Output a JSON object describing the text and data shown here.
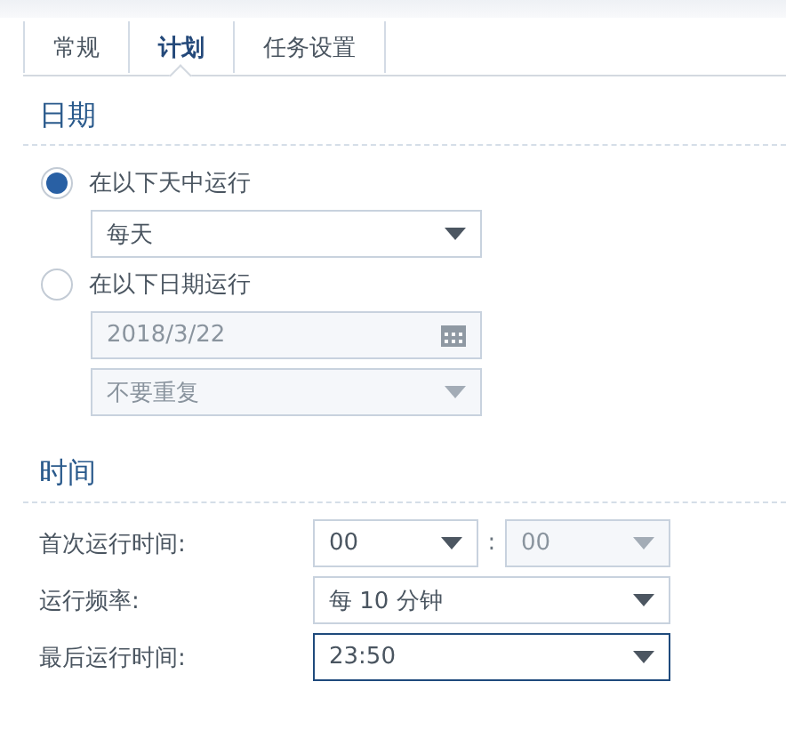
{
  "tabs": [
    {
      "label": "常规",
      "selected": false
    },
    {
      "label": "计划",
      "selected": true
    },
    {
      "label": "任务设置",
      "selected": false
    }
  ],
  "date_section": {
    "title": "日期",
    "options": [
      {
        "label": "在以下天中运行",
        "selected": true,
        "fields": [
          {
            "kind": "select",
            "value": "每天",
            "disabled": false
          }
        ]
      },
      {
        "label": "在以下日期运行",
        "selected": false,
        "fields": [
          {
            "kind": "date",
            "value": "2018/3/22",
            "disabled": true
          },
          {
            "kind": "select",
            "value": "不要重复",
            "disabled": true
          }
        ]
      }
    ]
  },
  "time_section": {
    "title": "时间",
    "rows": [
      {
        "label": "首次运行时间:",
        "kind": "time_pair",
        "hour": {
          "value": "00",
          "disabled": false
        },
        "separator": ":",
        "minute": {
          "value": "00",
          "disabled": true
        }
      },
      {
        "label": "运行频率:",
        "kind": "select",
        "value": "每 10 分钟",
        "disabled": false,
        "focused": false
      },
      {
        "label": "最后运行时间:",
        "kind": "select",
        "value": "23:50",
        "disabled": false,
        "focused": true
      }
    ]
  }
}
